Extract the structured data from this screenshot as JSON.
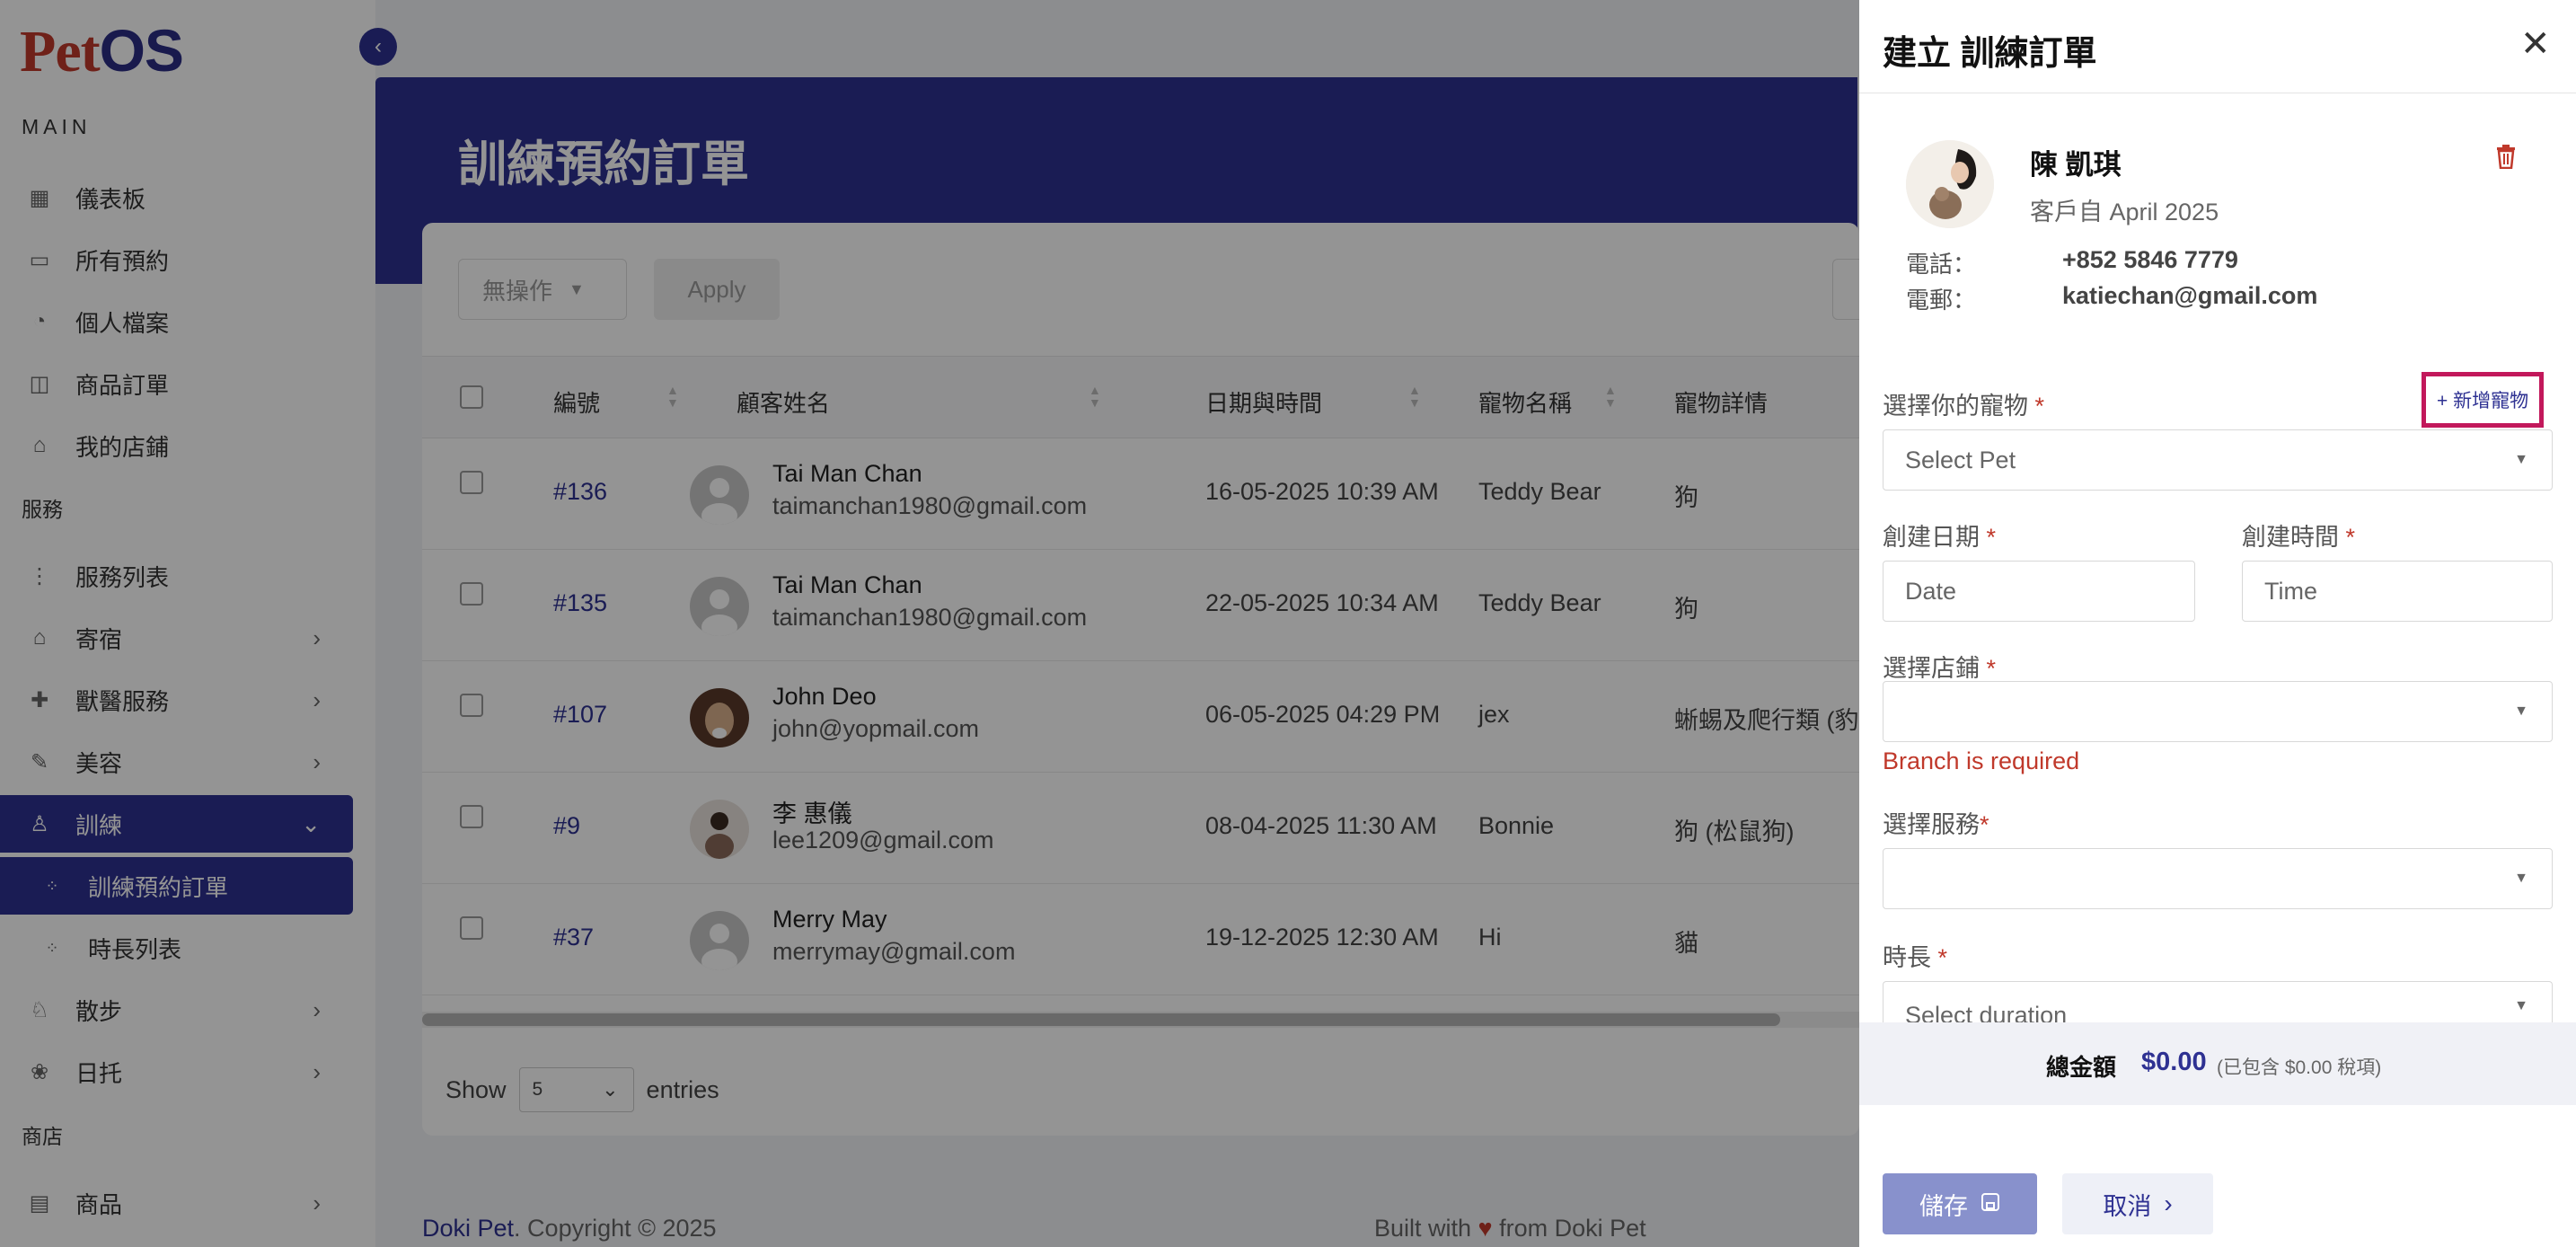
{
  "logo": {
    "pet": "Pet",
    "os": "OS"
  },
  "sidebar": {
    "section_main": "MAIN",
    "section_service": "服務",
    "section_shop": "商店",
    "items": [
      {
        "label": "儀表板",
        "icon": "grid-icon"
      },
      {
        "label": "所有預約",
        "icon": "calendar-icon"
      },
      {
        "label": "個人檔案",
        "icon": "user-icon"
      },
      {
        "label": "商品訂單",
        "icon": "bag-icon"
      },
      {
        "label": "我的店鋪",
        "icon": "store-icon"
      },
      {
        "label": "服務列表",
        "icon": "list-icon"
      },
      {
        "label": "寄宿",
        "icon": "house-icon"
      },
      {
        "label": "獸醫服務",
        "icon": "vet-icon"
      },
      {
        "label": "美容",
        "icon": "brush-icon"
      },
      {
        "label": "訓練",
        "icon": "training-icon"
      },
      {
        "label": "訓練預約訂單",
        "icon": "sub-icon"
      },
      {
        "label": "時長列表",
        "icon": "sub-icon"
      },
      {
        "label": "散步",
        "icon": "walk-icon"
      },
      {
        "label": "日托",
        "icon": "daycare-icon"
      },
      {
        "label": "商品",
        "icon": "product-icon"
      }
    ]
  },
  "page": {
    "title": "訓練預約訂單"
  },
  "toolbar": {
    "bulk_action": "無操作",
    "apply": "Apply"
  },
  "table": {
    "headers": [
      "編號",
      "顧客姓名",
      "日期與時間",
      "寵物名稱",
      "寵物詳情"
    ],
    "rows": [
      {
        "id": "#136",
        "name": "Tai Man Chan",
        "email": "taimanchan1980@gmail.com",
        "datetime": "16-05-2025 10:39 AM",
        "pet": "Teddy Bear",
        "detail": "狗"
      },
      {
        "id": "#135",
        "name": "Tai Man Chan",
        "email": "taimanchan1980@gmail.com",
        "datetime": "22-05-2025 10:34 AM",
        "pet": "Teddy Bear",
        "detail": "狗"
      },
      {
        "id": "#107",
        "name": "John Deo",
        "email": "john@yopmail.com",
        "datetime": "06-05-2025 04:29 PM",
        "pet": "jex",
        "detail": "蜥蜴及爬行類 (豹紋"
      },
      {
        "id": "#9",
        "name": "李 惠儀",
        "email": "lee1209@gmail.com",
        "datetime": "08-04-2025 11:30 AM",
        "pet": "Bonnie",
        "detail": "狗 (松鼠狗)"
      },
      {
        "id": "#37",
        "name": "Merry May",
        "email": "merrymay@gmail.com",
        "datetime": "19-12-2025 12:30 AM",
        "pet": "Hi",
        "detail": "貓"
      }
    ]
  },
  "pagination": {
    "show": "Show",
    "entries_value": "5",
    "entries": "entries"
  },
  "footer": {
    "brand": "Doki Pet",
    "copyright": ". Copyright © 2025",
    "built_pre": "Built with ",
    "built_post": " from Doki Pet"
  },
  "drawer": {
    "title": "建立 訓練訂單",
    "customer": {
      "name": "陳 凱琪",
      "since": "客戶自 April 2025",
      "phone_label": "電話：",
      "phone": "+852 5846 7779",
      "email_label": "電郵：",
      "email": "katiechan@gmail.com"
    },
    "pet_label": "選擇你的寵物",
    "add_pet": "+ 新增寵物",
    "pet_placeholder": "Select Pet",
    "date_label": "創建日期",
    "date_placeholder": "Date",
    "time_label": "創建時間",
    "time_placeholder": "Time",
    "branch_label": "選擇店鋪",
    "branch_error": "Branch is required",
    "service_label": "選擇服務",
    "duration_label": "時長",
    "duration_placeholder": "Select duration",
    "required_mark": "*",
    "total_label": "總金額",
    "total_value": "$0.00",
    "total_tax": "(已包含 $0.00 稅項)",
    "save": "儲存",
    "cancel": "取消"
  },
  "colors": {
    "primary": "#2e3192",
    "error": "#c0392b",
    "highlight": "#c2185b"
  }
}
